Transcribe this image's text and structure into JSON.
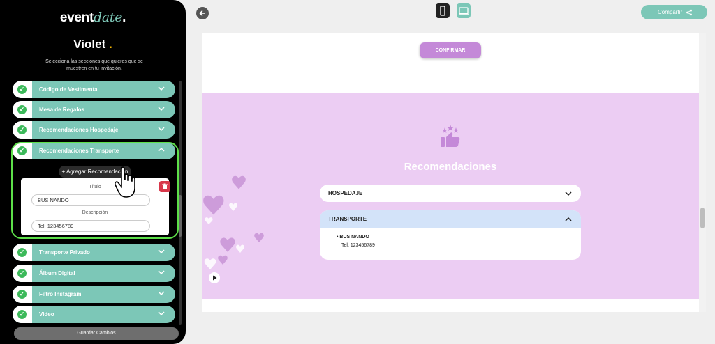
{
  "app": {
    "logo_main": "event",
    "logo_accent": "date",
    "logo_dot": "."
  },
  "sidebar": {
    "event_name": "Violet",
    "event_dot": ".",
    "instructions": "Selecciona las secciones que quieres que se muestren en tu invitación.",
    "sections": [
      {
        "label": "Código de Vestimenta"
      },
      {
        "label": "Mesa de Regalos"
      },
      {
        "label": "Recomendaciones Hospedaje"
      },
      {
        "label": "Recomendaciones Transporte"
      },
      {
        "label": "Transporte Privado"
      },
      {
        "label": "Álbum Digital"
      },
      {
        "label": "Filtro Instagram"
      },
      {
        "label": "Video"
      }
    ],
    "add_button": "+ Agregar Recomendación",
    "form": {
      "title_label": "Título",
      "title_value": "BUS NANDO",
      "description_label": "Descripción",
      "description_value": "Tel: 123456789"
    },
    "save_button": "Guardar Cambios"
  },
  "topbar": {
    "share_label": "Compartir"
  },
  "preview": {
    "confirm_button": "CONFIRMAR",
    "section_title": "Recomendaciones",
    "accordions": [
      {
        "title": "HOSPEDAJE",
        "expanded": false
      },
      {
        "title": "TRANSPORTE",
        "expanded": true,
        "items": [
          {
            "name": "BUS NANDO",
            "detail": "Tel: 123456789"
          }
        ]
      }
    ]
  },
  "colors": {
    "accent": "#7cc7b7",
    "check": "#3cb95a",
    "highlight_border": "#5ee04a",
    "pink_bg": "#eccdf3",
    "purple": "#c489d8",
    "transport_header": "#d3e3f9",
    "delete": "#d8374a"
  }
}
